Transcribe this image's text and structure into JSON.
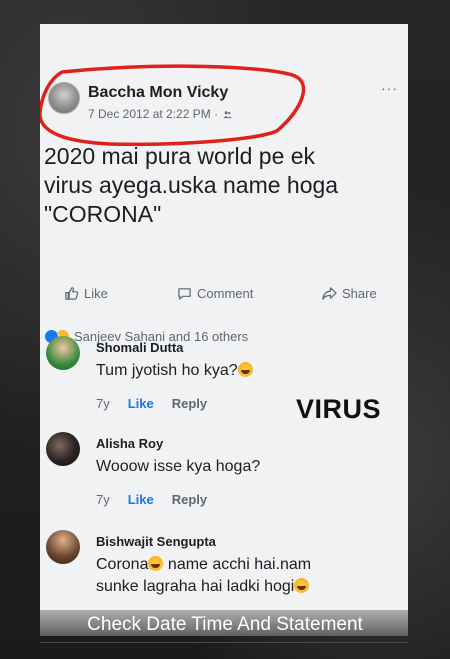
{
  "post": {
    "author": "Baccha Mon Vicky",
    "timestamp": "7 Dec 2012 at 2:22 PM",
    "audience_icon": "friends-icon",
    "text": "2020 mai pura world pe  ek\nvirus ayega.uska name hoga\n\"CORONA\"",
    "more_label": "···"
  },
  "actions": {
    "like_label": "Like",
    "comment_label": "Comment",
    "share_label": "Share"
  },
  "reactions": {
    "summary": "Sanjeev Sahani and 16 others"
  },
  "comments": [
    {
      "name": "Shomali Dutta",
      "text": "Tum jyotish ho kya?",
      "age": "7y",
      "like_label": "Like",
      "reply_label": "Reply"
    },
    {
      "name": "Alisha Roy",
      "text": "Wooow isse kya hoga?",
      "age": "7y",
      "like_label": "Like",
      "reply_label": "Reply"
    },
    {
      "name": "Bishwajit Sengupta",
      "text_a": "Corona",
      "text_b": " name acchi hai.nam",
      "text_c": "sunke lagraha hai ladki hogi"
    }
  ],
  "overlay": {
    "virus_label": "VIRUS",
    "caption": "Check Date Time And Statement"
  },
  "colors": {
    "link_blue": "#1877f2",
    "annotation_red": "#e0201b"
  }
}
